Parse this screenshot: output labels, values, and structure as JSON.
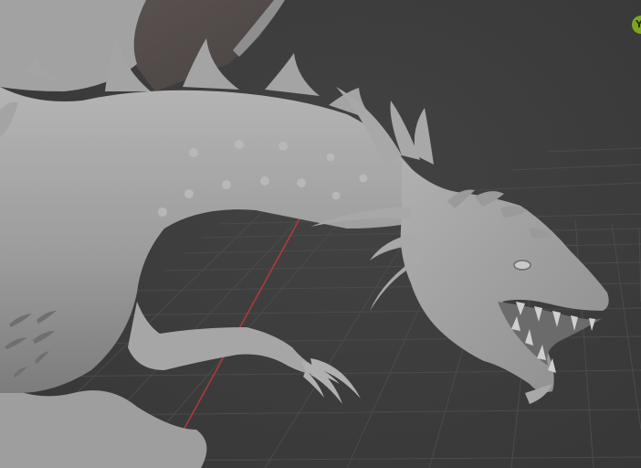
{
  "viewport": {
    "background": "#3d3d3d",
    "grid_color": "#4a4a4a",
    "x_axis_color": "#b03a3a",
    "model_color": "#9b9b9b"
  },
  "gizmo": {
    "icon": "navigation-gizmo-y-axis-icon",
    "label": "Y",
    "color": "#7ea51f"
  }
}
